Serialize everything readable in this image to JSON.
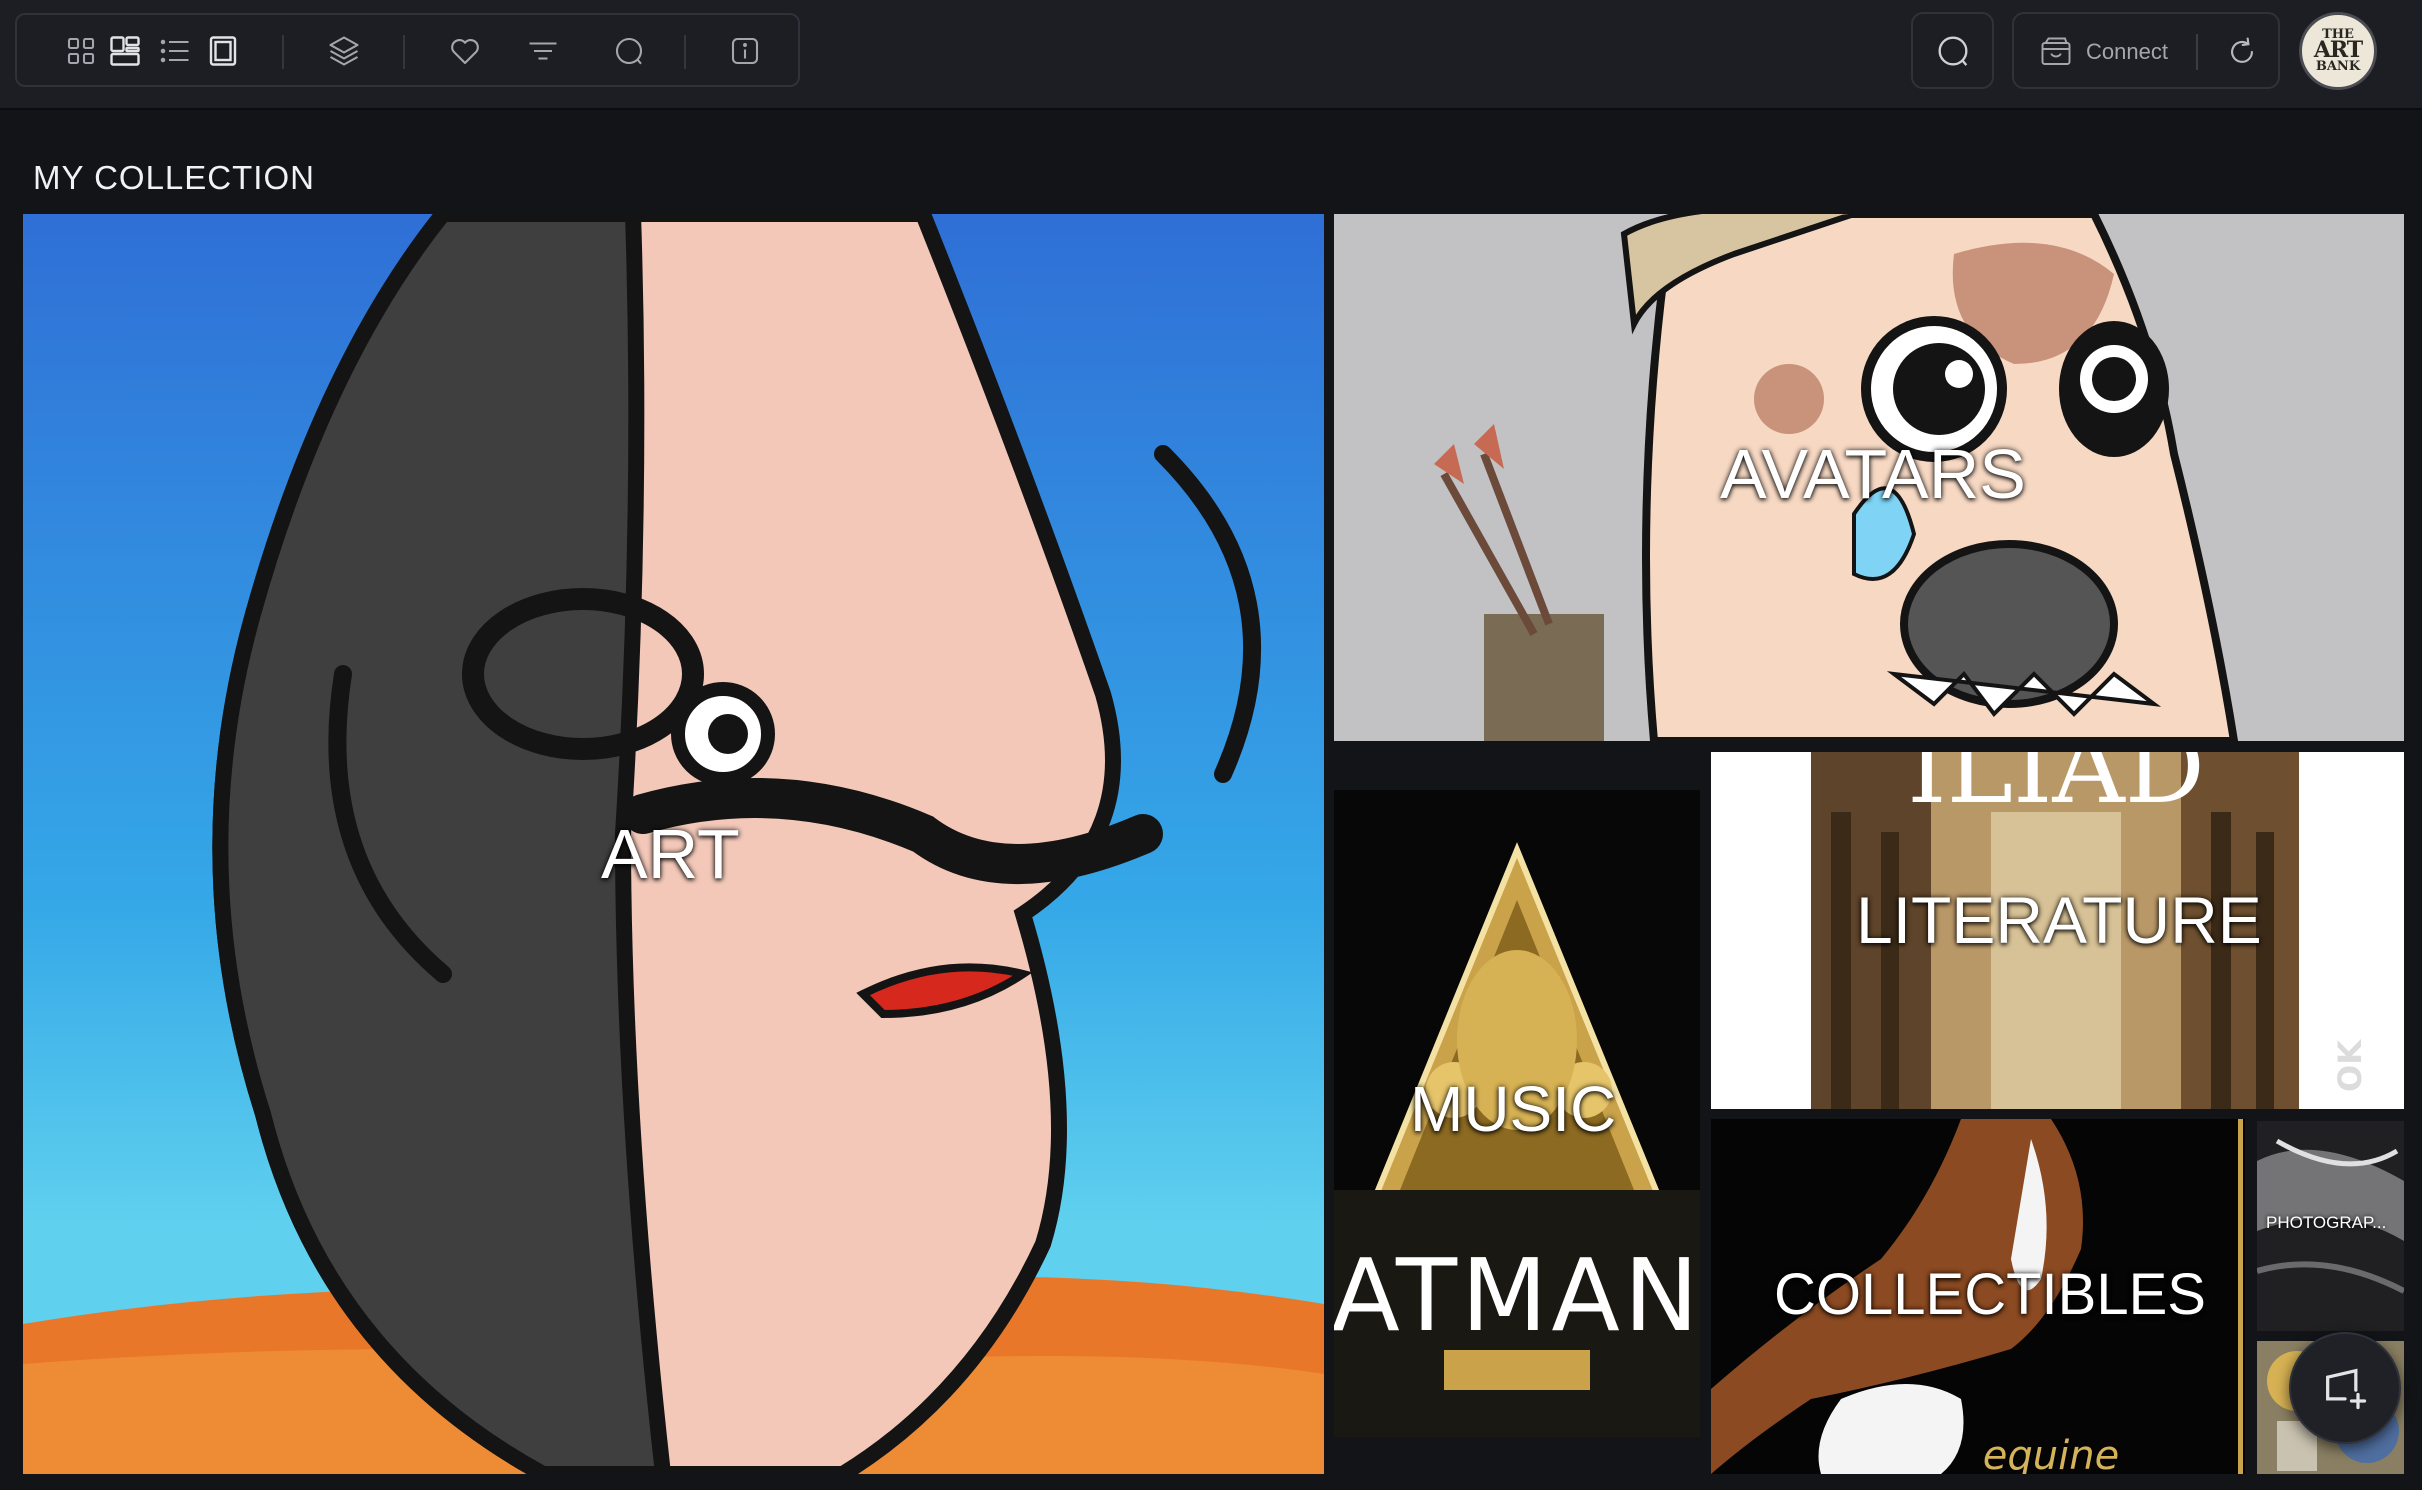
{
  "toolbar": {
    "icons": [
      "grid-view-icon",
      "masonry-view-icon",
      "list-view-icon",
      "single-view-icon",
      "layers-icon",
      "heart-icon",
      "filter-icon",
      "chat-icon",
      "info-icon"
    ]
  },
  "header": {
    "connect_label": "Connect",
    "logo_line1": "THE",
    "logo_line2": "ART",
    "logo_line3": "BANK"
  },
  "main": {
    "section_title": "MY COLLECTION",
    "tiles": {
      "art": "ART",
      "avatars": "AVATARS",
      "music": "MUSIC",
      "literature": "LITERATURE",
      "collectibles": "COLLECTIBLES",
      "photography": "PHOTOGRAP..."
    },
    "music_logo_text": "ATMAN",
    "literature_title_text": "ILIAD",
    "literature_side_text": "OK",
    "collectibles_brand_text": "equine"
  },
  "colors": {
    "background": "#121418",
    "topbar": "#1c1e24",
    "border": "#2f323a",
    "text": "#e8e8ea"
  }
}
